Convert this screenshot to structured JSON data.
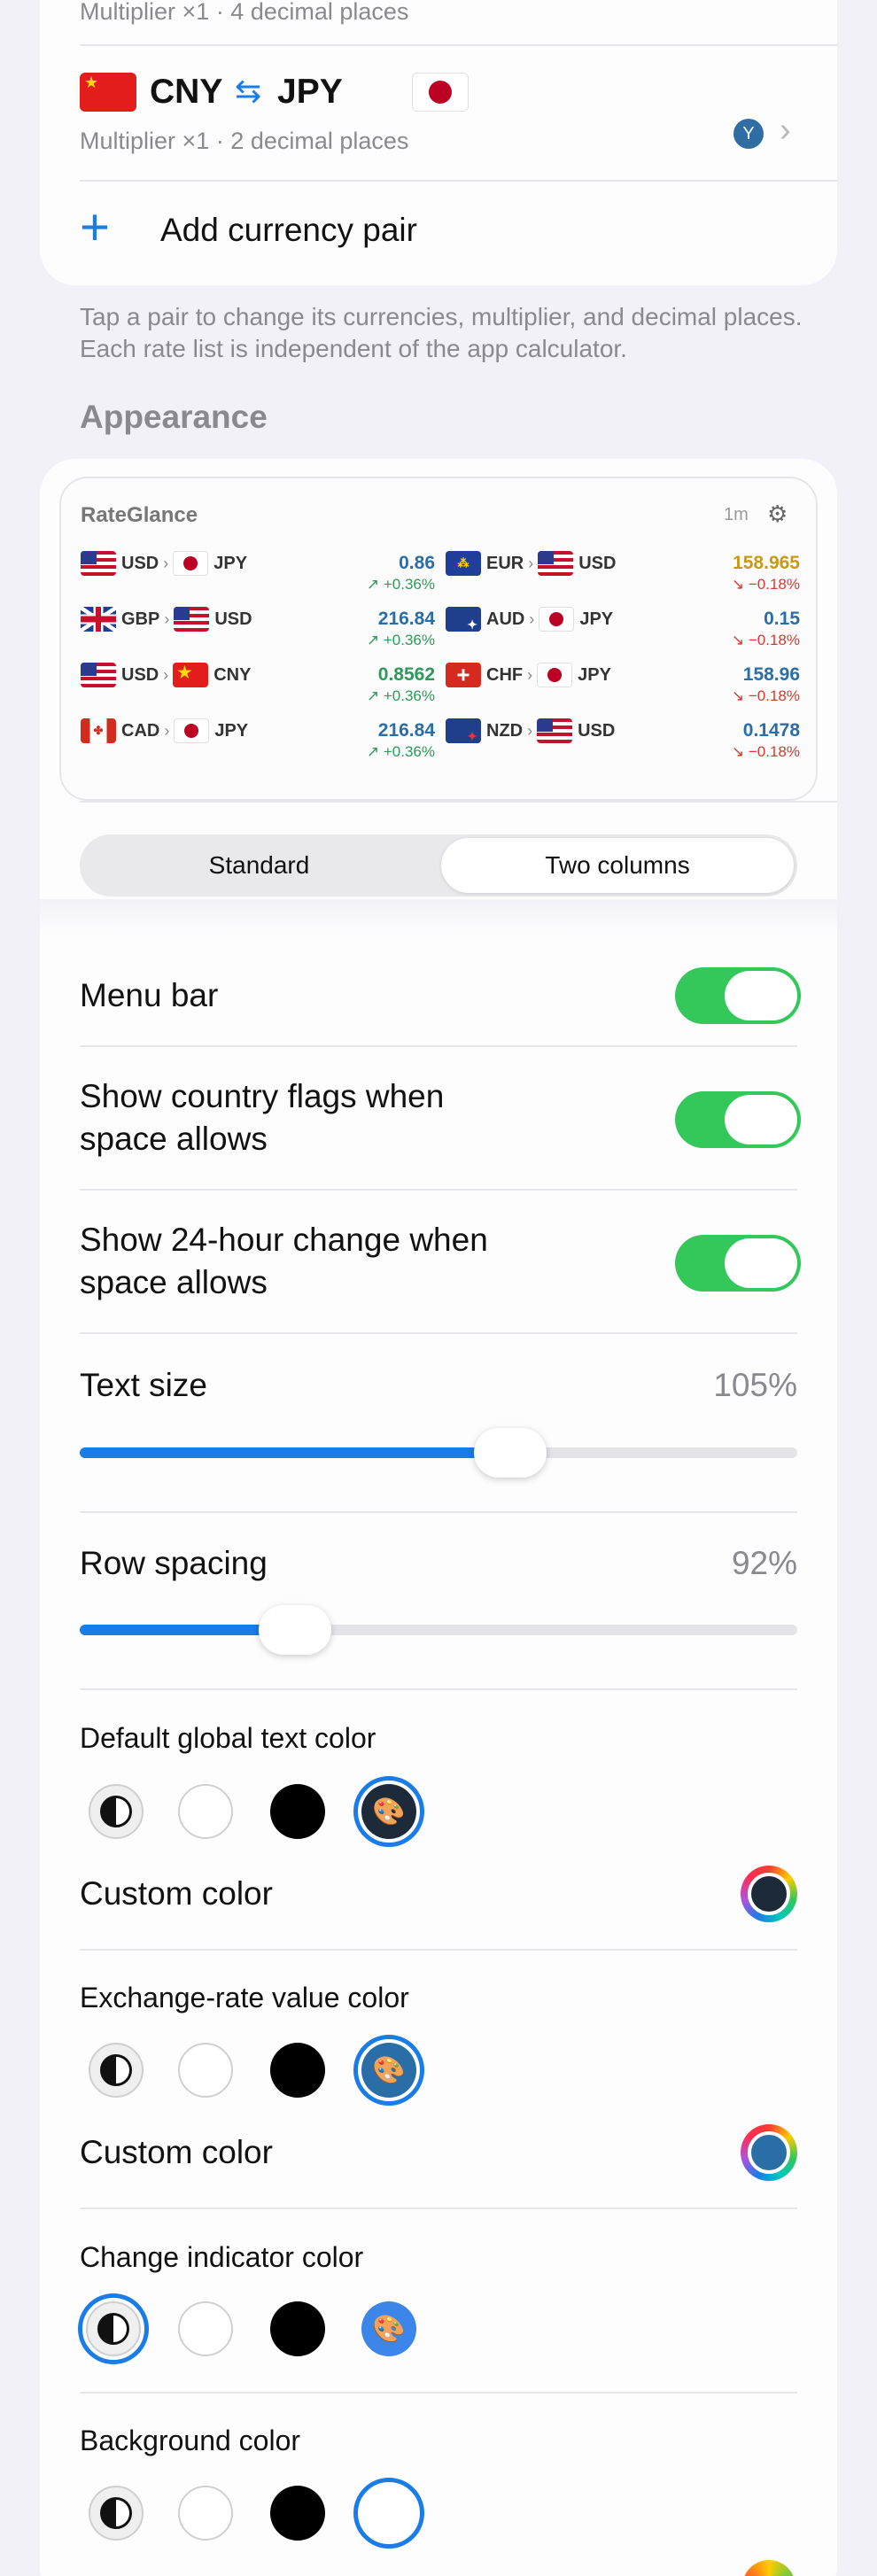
{
  "pairs": {
    "prev_subtitle": "Multiplier ×1 · 4 decimal places",
    "cny_jpy": {
      "from": "CNY",
      "to": "JPY",
      "subtitle": "Multiplier ×1 · 2 decimal places",
      "swap_glyph": "⇆"
    },
    "add_label": "Add currency pair",
    "footer_note": "Tap a pair to change its currencies, multiplier, and decimal places. Each rate list is independent of the app calculator."
  },
  "appearance": {
    "heading": "Appearance",
    "widget": {
      "title": "RateGlance",
      "age": "1m",
      "left_rows": [
        {
          "from": "USD",
          "to": "JPY",
          "value": "0.86",
          "change": "↗ +0.36%"
        },
        {
          "from": "GBP",
          "to": "USD",
          "value": "216.84",
          "change": "↗ +0.36%"
        },
        {
          "from": "USD",
          "to": "CNY",
          "value": "0.8562",
          "change": "↗ +0.36%"
        },
        {
          "from": "CAD",
          "to": "JPY",
          "value": "216.84",
          "change": "↗ +0.36%"
        }
      ],
      "right_rows": [
        {
          "from": "EUR",
          "to": "USD",
          "value": "158.965",
          "change": "↘ −0.18%"
        },
        {
          "from": "AUD",
          "to": "JPY",
          "value": "0.15",
          "change": "↘ −0.18%"
        },
        {
          "from": "CHF",
          "to": "JPY",
          "value": "158.96",
          "change": "↘ −0.18%"
        },
        {
          "from": "NZD",
          "to": "USD",
          "value": "0.1478",
          "change": "↘ −0.18%"
        }
      ]
    },
    "layout_segment": {
      "options": [
        "Standard",
        "Two columns"
      ],
      "selected": "Two columns"
    },
    "toggles": {
      "menu_bar": {
        "label": "Menu bar",
        "on": true
      },
      "flags": {
        "label": "Show country flags when space allows",
        "on": true
      },
      "change": {
        "label": "Show 24-hour change when space allows",
        "on": true
      }
    },
    "text_size": {
      "label": "Text size",
      "value_text": "105%",
      "level": 0.6
    },
    "row_spacing": {
      "label": "Row spacing",
      "value_text": "92%",
      "level": 0.3
    },
    "color_sections": {
      "global_text": {
        "label": "Default global text color",
        "custom_label": "Custom color",
        "custom_color": "#1c2a3a"
      },
      "rate_value": {
        "label": "Exchange-rate value color",
        "custom_label": "Custom color",
        "custom_color": "#2a6ea8"
      },
      "change_indicator": {
        "label": "Change indicator color"
      },
      "background": {
        "label": "Background color"
      }
    }
  },
  "colors": {
    "accent": "#1a7ce6",
    "toggle_on": "#34c759",
    "up": "#2e9a5a",
    "down": "#d93a2f",
    "rate_blue": "#2a6ea8",
    "rate_gold": "#c99a16"
  },
  "icons": [
    "swap-icon",
    "user-badge-icon",
    "chevron-right-icon",
    "plus-icon",
    "gear-icon",
    "palette-icon",
    "color-wheel-icon",
    "contrast-icon"
  ]
}
